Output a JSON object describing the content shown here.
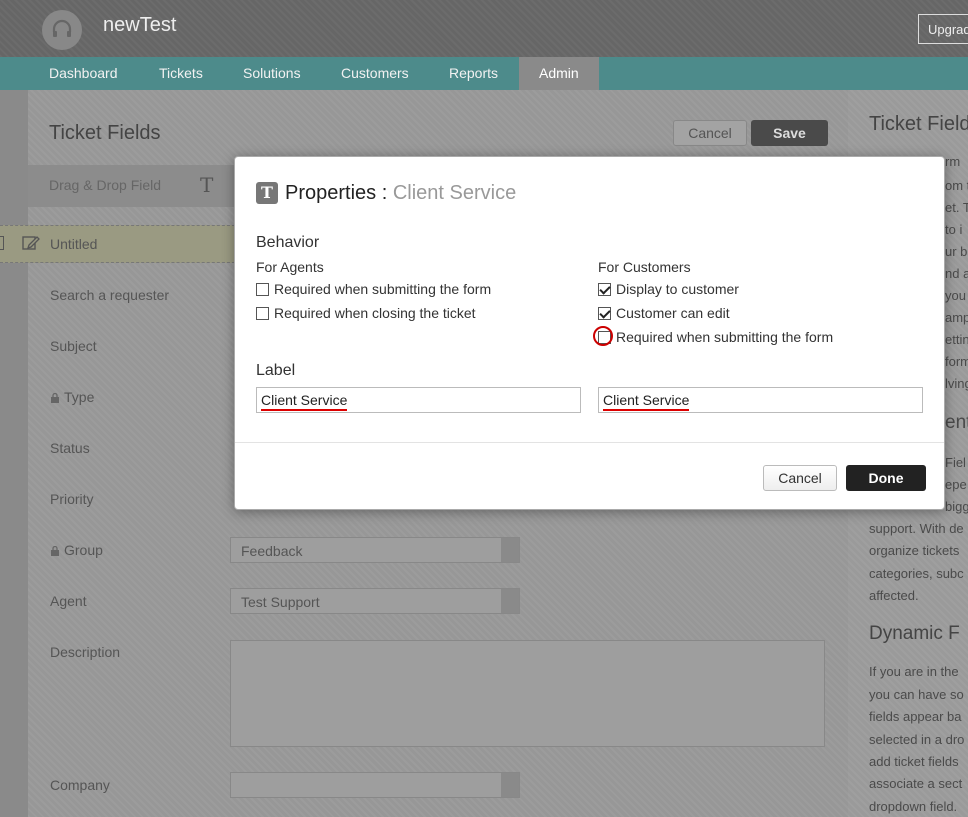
{
  "app": {
    "title": "newTest",
    "upgrade_label": "Upgrade"
  },
  "nav": {
    "tabs": [
      {
        "label": "Dashboard"
      },
      {
        "label": "Tickets"
      },
      {
        "label": "Solutions"
      },
      {
        "label": "Customers"
      },
      {
        "label": "Reports"
      },
      {
        "label": "Admin",
        "active": true
      }
    ]
  },
  "page": {
    "title": "Ticket Fields",
    "cancel_label": "Cancel",
    "save_label": "Save",
    "drag_drop_label": "Drag & Drop Field",
    "untitled_label": "Untitled",
    "fields": {
      "search_requester": "Search a requester",
      "subject": "Subject",
      "type": "Type",
      "status": "Status",
      "priority": "Priority",
      "group": "Group",
      "agent": "Agent",
      "description": "Description",
      "company": "Company"
    },
    "group_value": "Feedback",
    "agent_value": "Test Support"
  },
  "right_panel": {
    "title": "Ticket Fields",
    "lines_top": [
      "rm",
      "om t",
      "et. T",
      "to i",
      "ur b",
      "nd a",
      "you",
      "amp",
      "ettin",
      "form",
      "lving"
    ],
    "frag_heading": "ent",
    "frag_mid": [
      "Fiel",
      "epe",
      "bigg"
    ],
    "para_lines": [
      "support. With de",
      "organize tickets",
      "categories, subc",
      "affected."
    ],
    "subheading": "Dynamic F",
    "para2_lines": [
      "If you are in the",
      "you can have so",
      "fields appear ba",
      "selected in a dro",
      "add ticket fields",
      "associate a sect",
      "dropdown field."
    ]
  },
  "modal": {
    "title": "Properties :",
    "subtitle": "Client Service",
    "behavior_title": "Behavior",
    "agents_title": "For Agents",
    "customers_title": "For Customers",
    "agents": [
      {
        "label": "Required when submitting the form",
        "checked": false
      },
      {
        "label": "Required when closing the ticket",
        "checked": false
      }
    ],
    "customers": [
      {
        "label": "Display to customer",
        "checked": true
      },
      {
        "label": "Customer can edit",
        "checked": true
      },
      {
        "label": "Required when submitting the form",
        "checked": false
      }
    ],
    "label_title": "Label",
    "agent_label_value": "Client Service",
    "customer_label_value": "Client Service",
    "cancel_label": "Cancel",
    "done_label": "Done"
  }
}
